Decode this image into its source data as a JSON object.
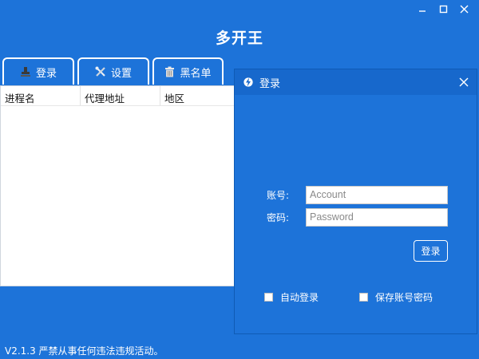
{
  "window": {
    "controls": {
      "minimize_icon": "minimize-icon",
      "maximize_icon": "maximize-icon",
      "close_icon": "close-icon"
    }
  },
  "app": {
    "title": "多开王"
  },
  "tabs": [
    {
      "label": "登录",
      "icon": "stamp-icon"
    },
    {
      "label": "设置",
      "icon": "tools-icon"
    },
    {
      "label": "黑名单",
      "icon": "trash-icon"
    }
  ],
  "table": {
    "columns": [
      "进程名",
      "代理地址",
      "地区"
    ],
    "rows": []
  },
  "footer": {
    "text": "V2.1.3 严禁从事任何违法违规活动。"
  },
  "login_dialog": {
    "title": "登录",
    "logo_icon": "lightning-logo-icon",
    "account": {
      "label": "账号:",
      "placeholder": "Account",
      "value": ""
    },
    "password": {
      "label": "密码:",
      "placeholder": "Password",
      "value": ""
    },
    "submit_label": "登录",
    "auto_login": {
      "label": "自动登录",
      "checked": false
    },
    "remember": {
      "label": "保存账号密码",
      "checked": false
    }
  },
  "colors": {
    "background": "#1d73d9",
    "dialog_titlebar": "#1768cc",
    "text": "#ffffff"
  }
}
